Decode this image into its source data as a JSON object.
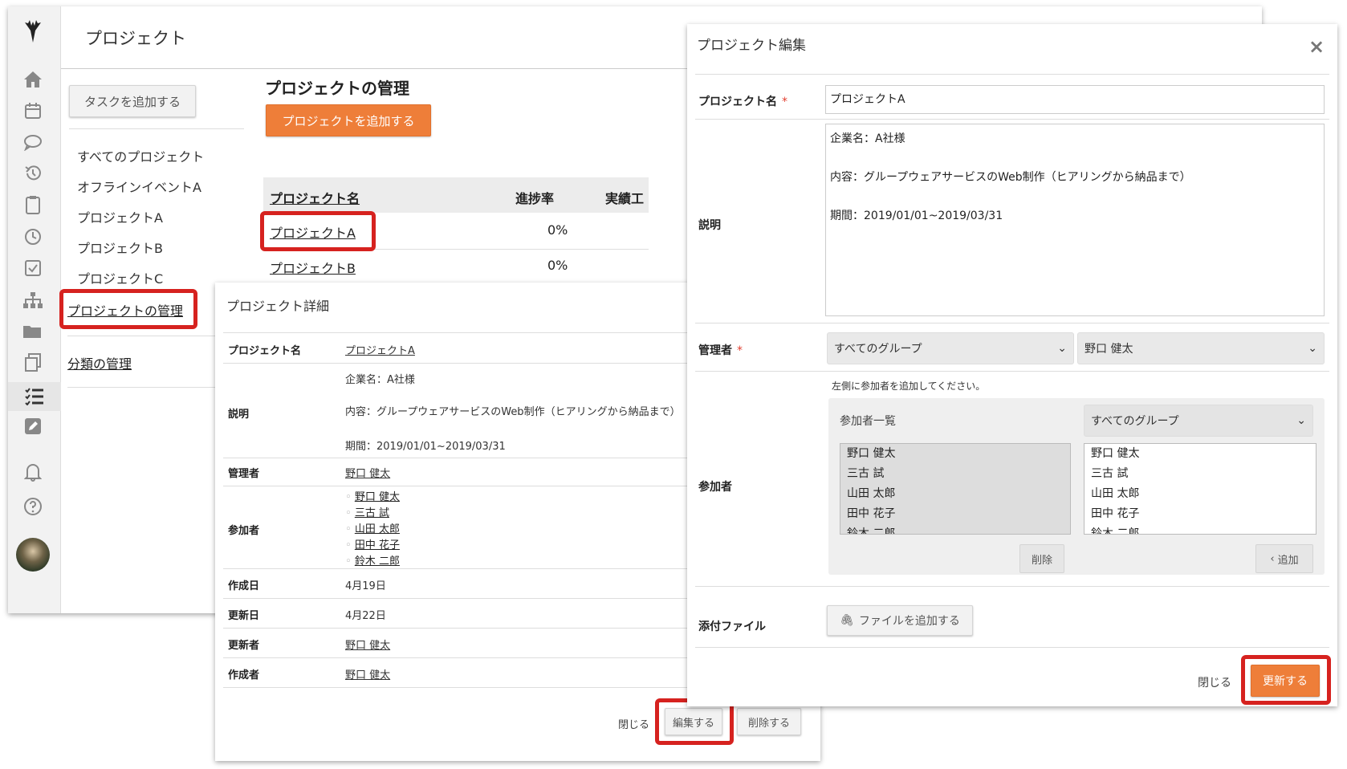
{
  "app": {
    "title": "プロジェクト",
    "add_task_button": "タスクを追加する",
    "nav_items": [
      "すべてのプロジェクト",
      "オフラインイベントA",
      "プロジェクトA",
      "プロジェクトB",
      "プロジェクトC"
    ],
    "manage_projects_link": "プロジェクトの管理",
    "manage_categories_link": "分類の管理",
    "rail_icons": [
      "logo-icon",
      "home-icon",
      "calendar-icon",
      "chat-icon",
      "history-icon",
      "clipboard-icon",
      "clock-icon",
      "checkbox-icon",
      "org-chart-icon",
      "folder-icon",
      "copy-icon",
      "task-list-icon",
      "edit-icon",
      "bell-icon",
      "help-icon",
      "avatar"
    ]
  },
  "manage": {
    "heading": "プロジェクトの管理",
    "add_project_button": "プロジェクトを追加する",
    "columns": [
      "プロジェクト名",
      "進捗率",
      "実績工"
    ],
    "rows": [
      {
        "name": "プロジェクトA",
        "progress": "0%"
      },
      {
        "name": "プロジェクトB",
        "progress": "0%"
      }
    ]
  },
  "detail": {
    "title": "プロジェクト詳細",
    "labels": {
      "name": "プロジェクト名",
      "description": "説明",
      "manager": "管理者",
      "participants": "参加者",
      "created": "作成日",
      "updated": "更新日",
      "updated_by": "更新者",
      "created_by": "作成者"
    },
    "name": "プロジェクトA",
    "description_lines": [
      "企業名：A社様",
      "内容：グループウェアサービスのWeb制作（ヒアリングから納品まで）",
      "期間：2019/01/01~2019/03/31"
    ],
    "manager": "野口 健太",
    "participants": [
      "野口 健太",
      "三古 試",
      "山田 太郎",
      "田中 花子",
      "鈴木 二郎"
    ],
    "created": "4月19日",
    "updated": "4月22日",
    "updated_by": "野口 健太",
    "created_by": "野口 健太",
    "close_link": "閉じる",
    "edit_button": "編集する",
    "delete_button": "削除する"
  },
  "edit": {
    "title": "プロジェクト編集",
    "close_icon": "×",
    "labels": {
      "name": "プロジェクト名",
      "description": "説明",
      "manager": "管理者",
      "participants": "参加者",
      "attachments": "添付ファイル"
    },
    "required_mark": "*",
    "name_value": "プロジェクトA",
    "description_lines": [
      "企業名：A社様",
      "",
      "内容：グループウェアサービスのWeb制作（ヒアリングから納品まで）",
      "",
      "期間：2019/01/01~2019/03/31"
    ],
    "manager_group": "すべてのグループ",
    "manager_user": "野口 健太",
    "participants_hint": "左側に参加者を追加してください。",
    "participant_list_label": "参加者一覧",
    "participant_group": "すべてのグループ",
    "selected_participants": [
      "野口 健太",
      "三古 試",
      "山田 太郎",
      "田中 花子",
      "鈴木 二郎"
    ],
    "available_participants": [
      "野口 健太",
      "三古 試",
      "山田 太郎",
      "田中 花子",
      "鈴木 二郎"
    ],
    "remove_button": "削除",
    "add_button": "追加",
    "add_file_button": "ファイルを追加する",
    "close_link": "閉じる",
    "update_button": "更新する"
  }
}
